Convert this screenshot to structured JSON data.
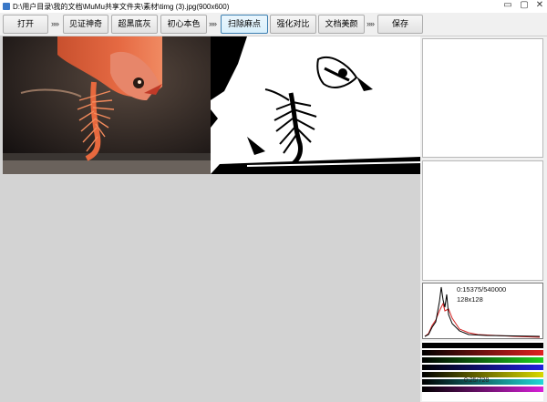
{
  "window": {
    "title": "D:\\用户目录\\我的文档\\MuMu共享文件夹\\素材\\timg (3).jpg(900x600)",
    "controls": [
      "▭",
      "▢",
      "✕"
    ]
  },
  "toolbar": {
    "open_label": "打开",
    "separator": "»»",
    "witness_label": "见证神奇",
    "superblack_label": "超黑底灰",
    "original_label": "初心本色",
    "sweep_label": "扫除麻点",
    "contrast_label": "强化对比",
    "beautify_label": "文档美颜",
    "save_label": "保存",
    "active_button": "扫除麻点"
  },
  "histogram": {
    "stats": "0:15375/540000",
    "size": "128x128",
    "line_colors": [
      "#000000",
      "#d42020"
    ]
  },
  "channel_bars": {
    "colors": [
      "#000000",
      "#e02020",
      "#20d020",
      "#2020e0",
      "#d8d800",
      "#20d8d8",
      "#d820d8"
    ],
    "labels": [
      "",
      "",
      "",
      "",
      "",
      "0:25/728",
      ""
    ]
  },
  "colors": {
    "toolbar_bg": "#f0f0f0",
    "canvas_bg": "#d3d3d3",
    "active_border": "#3c7fb1"
  }
}
